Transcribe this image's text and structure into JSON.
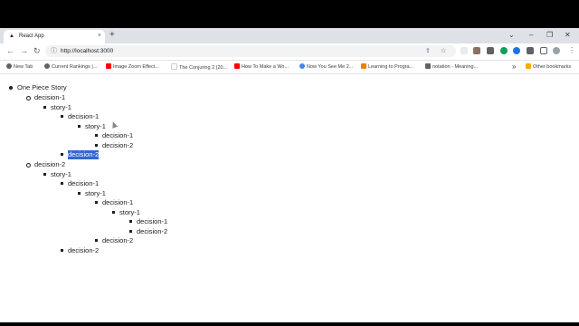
{
  "browser": {
    "tab": {
      "title": "React App",
      "favicon": "▲",
      "close": "×"
    },
    "new_tab": "+",
    "window_controls": [
      "⌄",
      "–",
      "❐",
      "✕"
    ],
    "toolbar": {
      "back": "←",
      "forward": "→",
      "reload": "↻",
      "url": "http://localhost:3000",
      "info_icon": "ⓘ",
      "share_icon": "⇪",
      "star_icon": "☆",
      "menu_icon": "⋮"
    },
    "extension_colors": [
      "#e8eaed",
      "#5f6368",
      "#0f9d58",
      "#1a73e8",
      "#5f6368",
      "#5f6368",
      "#9aa0a6"
    ],
    "bookmarks": [
      {
        "label": "New Tab",
        "icon": "globe-icon",
        "glyph": "🌐",
        "color": "#5f6368"
      },
      {
        "label": "Current Rankings |...",
        "icon": "globe-icon",
        "glyph": "🌐",
        "color": "#5f6368"
      },
      {
        "label": "Image Zoom Effect...",
        "icon": "youtube-icon",
        "glyph": "",
        "color": "#ff0000"
      },
      {
        "label": "The Conjuring 2 (20...",
        "icon": "page-icon",
        "glyph": "",
        "color": "#ffffff"
      },
      {
        "label": "How To Make a Wo...",
        "icon": "youtube-icon",
        "glyph": "",
        "color": "#ff0000"
      },
      {
        "label": "Now You See Me 2...",
        "icon": "google-icon",
        "glyph": "",
        "color": "#4285f4"
      },
      {
        "label": "Learning to Progra...",
        "icon": "blogger-icon",
        "glyph": "",
        "color": "#f57d00"
      },
      {
        "label": "notation - Meaning...",
        "icon": "stack-icon",
        "glyph": "",
        "color": "#5f6368"
      }
    ],
    "bookmarks_overflow": "»",
    "other_bookmarks": "Other bookmarks"
  },
  "tree": {
    "root": "One Piece Story",
    "d1": "decision-1",
    "d1_s": "story-1",
    "d1_s_d1": "decision-1",
    "d1_s_d1_s": "story-1",
    "d1_s_d1_s_d1": "decision-1",
    "d1_s_d1_s_d2": "decision-2",
    "d1_s_d2": "decision-2",
    "d2": "decision-2",
    "d2_s": "story-1",
    "d2_s_d1": "decision-1",
    "d2_s_d1_s": "story-1",
    "d2_s_d1_s_d1": "decision-1",
    "d2_s_d1_s_d1_s": "story-1",
    "d2_s_d1_s_d1_s_d1": "decision-1",
    "d2_s_d1_s_d1_s_d2": "decision-2",
    "d2_s_d1_s_d2": "decision-2",
    "d2_s_d2": "decision-2"
  }
}
